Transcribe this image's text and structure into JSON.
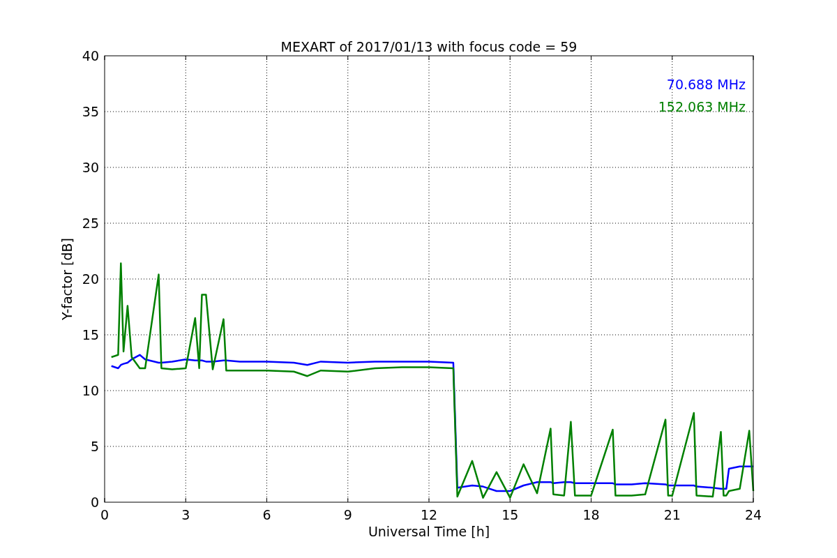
{
  "chart_data": {
    "type": "line",
    "title": "MEXART of 2017/01/13 with focus code = 59",
    "xlabel": "Universal Time [h]",
    "ylabel": "Y-factor [dB]",
    "xlim": [
      0,
      24
    ],
    "ylim": [
      0,
      40
    ],
    "xticks": [
      0,
      3,
      6,
      9,
      12,
      15,
      18,
      21,
      24
    ],
    "yticks": [
      0,
      5,
      10,
      15,
      20,
      25,
      30,
      35,
      40
    ],
    "grid": true,
    "x": [
      0.25,
      0.5,
      0.6,
      0.7,
      0.85,
      1,
      1.3,
      1.5,
      2,
      2.1,
      2.5,
      3,
      3.35,
      3.5,
      3.6,
      3.75,
      4,
      4.4,
      4.5,
      5,
      6,
      7,
      7.5,
      8,
      9,
      10,
      11,
      12,
      12.9,
      13.05,
      13.6,
      14,
      14.5,
      15,
      15.5,
      16,
      16.5,
      16.6,
      17,
      17.25,
      17.4,
      18,
      18.8,
      18.9,
      19.5,
      20,
      20.75,
      20.85,
      21,
      21.8,
      21.9,
      22.5,
      22.8,
      22.9,
      23,
      23.1,
      23.5,
      23.85,
      24
    ],
    "series": [
      {
        "name": "70.688 MHz",
        "color": "#0000ff",
        "values": [
          12.2,
          12,
          12.3,
          12.4,
          12.5,
          12.8,
          13.2,
          12.8,
          12.5,
          12.5,
          12.6,
          12.8,
          12.7,
          12.7,
          12.7,
          12.6,
          12.6,
          12.7,
          12.7,
          12.6,
          12.6,
          12.5,
          12.3,
          12.6,
          12.5,
          12.6,
          12.6,
          12.6,
          12.5,
          1.3,
          1.5,
          1.4,
          1,
          1,
          1.5,
          1.8,
          1.8,
          1.7,
          1.8,
          1.8,
          1.7,
          1.7,
          1.7,
          1.6,
          1.6,
          1.7,
          1.6,
          1.5,
          1.5,
          1.5,
          1.4,
          1.3,
          1.2,
          1.2,
          1.2,
          3,
          3.2,
          3.2,
          3.2
        ]
      },
      {
        "name": "152.063 MHz",
        "color": "#008000",
        "values": [
          13,
          13.2,
          21.4,
          13.5,
          17.6,
          13,
          12,
          12,
          20.4,
          12,
          11.9,
          12,
          16.5,
          12,
          18.6,
          18.6,
          11.9,
          16.4,
          11.8,
          11.8,
          11.8,
          11.7,
          11.3,
          11.8,
          11.7,
          12,
          12.1,
          12.1,
          12,
          0.5,
          3.7,
          0.4,
          2.7,
          0.4,
          3.4,
          0.8,
          6.6,
          0.7,
          0.6,
          7.2,
          0.6,
          0.6,
          6.5,
          0.6,
          0.6,
          0.7,
          7.4,
          0.6,
          0.6,
          8,
          0.6,
          0.5,
          6.3,
          0.6,
          0.6,
          1,
          1.2,
          6.4,
          1
        ]
      }
    ]
  }
}
